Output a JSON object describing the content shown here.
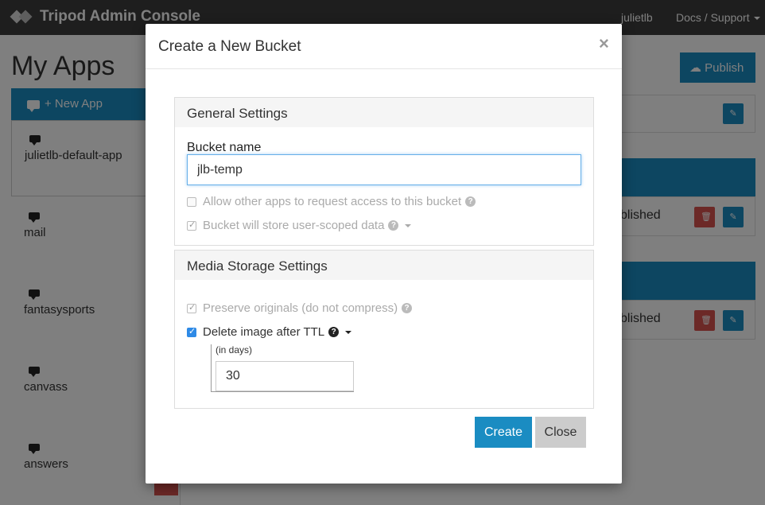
{
  "navbar": {
    "brand": "Tripod Admin Console",
    "user": "julietlb",
    "docs": "Docs / Support"
  },
  "page": {
    "title": "My Apps",
    "new_app_label": "+ New App",
    "publish_label": "Publish",
    "apps": [
      {
        "name": "julietlb-default-app"
      },
      {
        "name": "mail"
      },
      {
        "name": "fantasysports"
      },
      {
        "name": "canvass"
      },
      {
        "name": "answers"
      }
    ],
    "row_status_1": "blished",
    "row_status_2": "blished"
  },
  "modal": {
    "title": "Create a New Bucket",
    "close_glyph": "×",
    "general": {
      "heading": "General Settings",
      "bucket_name_label": "Bucket name",
      "bucket_name_value": "jlb-temp",
      "allow_access_label": "Allow other apps to request access to this bucket",
      "allow_access_checked": false,
      "user_scoped_label": "Bucket will store user-scoped data",
      "user_scoped_checked": true
    },
    "media": {
      "heading": "Media Storage Settings",
      "preserve_label": "Preserve originals (do not compress)",
      "preserve_checked": true,
      "delete_ttl_label": "Delete image after TTL",
      "delete_ttl_checked": true,
      "ttl_unit": "(in days)",
      "ttl_value": "30"
    },
    "create_label": "Create",
    "close_label": "Close"
  },
  "colors": {
    "accent": "#1a8cc2",
    "danger": "#d9534f",
    "navbar": "#3d3d3d"
  }
}
